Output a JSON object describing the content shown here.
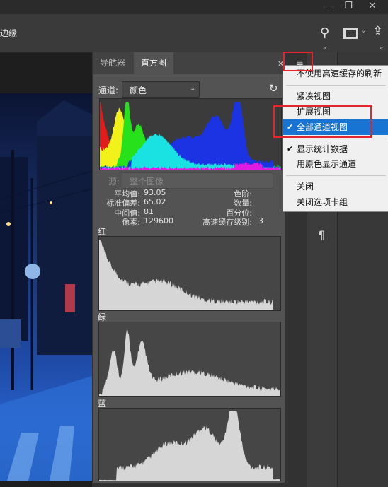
{
  "window": {
    "minimize_glyph": "—",
    "restore_glyph": "❐",
    "close_glyph": "✕"
  },
  "options_bar": {
    "edge_label": "边缘",
    "search_glyph": "⚲",
    "share_glyph": "⇪"
  },
  "panel": {
    "tabs": [
      {
        "label": "导航器"
      },
      {
        "label": "直方图"
      }
    ],
    "close_glyph": "✕",
    "menu_glyph": "≡",
    "channel_label": "通道:",
    "channel_value": "颜色",
    "refresh_glyph": "↻",
    "warning_glyph": "⚠",
    "source_label": "源:",
    "source_value": "整个图像",
    "stats_left": [
      {
        "label": "平均值:",
        "value": "93.05"
      },
      {
        "label": "标准偏差:",
        "value": "65.02"
      },
      {
        "label": "中间值:",
        "value": "81"
      },
      {
        "label": "像素:",
        "value": "129600"
      }
    ],
    "stats_right": [
      {
        "label": "色阶:",
        "value": ""
      },
      {
        "label": "数量:",
        "value": ""
      },
      {
        "label": "百分位:",
        "value": ""
      },
      {
        "label": "高速缓存级别:",
        "value": "3"
      }
    ],
    "channels": [
      {
        "label": "红"
      },
      {
        "label": "绿"
      },
      {
        "label": "蓝"
      }
    ]
  },
  "menu": {
    "items": [
      {
        "label": "不使用高速缓存的刷新",
        "checked": false
      },
      {
        "label": "紧凑视图",
        "checked": false
      },
      {
        "label": "扩展视图",
        "checked": false
      },
      {
        "label": "全部通道视图",
        "checked": true,
        "highlighted": true
      },
      {
        "label": "显示统计数据",
        "checked": true
      },
      {
        "label": "用原色显示通道",
        "checked": false
      },
      {
        "label": "关闭",
        "checked": false
      },
      {
        "label": "关闭选项卡组",
        "checked": false
      }
    ],
    "check_glyph": "✔"
  },
  "dock": {
    "paragraph_glyph": "¶",
    "collapse_glyph": "«"
  },
  "colors": {
    "menu_highlight": "#1874d2",
    "annotation_red": "#e8242b",
    "histogram_fill": "#d6d6d6"
  }
}
